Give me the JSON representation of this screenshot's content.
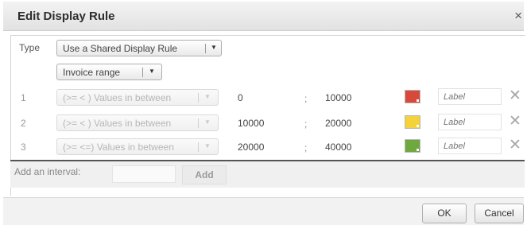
{
  "dialog": {
    "title": "Edit Display Rule",
    "close_symbol": "×"
  },
  "type_row": {
    "label": "Type",
    "value": "Use a Shared Display Rule"
  },
  "shared_rule": {
    "value": "Invoice range"
  },
  "intervals": [
    {
      "index": "1",
      "operator": "(>= < ) Values in between",
      "from": "0",
      "separator": ";",
      "to": "10000",
      "color": "#d7493a",
      "label_placeholder": "Label"
    },
    {
      "index": "2",
      "operator": "(>= < ) Values in between",
      "from": "10000",
      "separator": ";",
      "to": "20000",
      "color": "#f3d23c",
      "label_placeholder": "Label"
    },
    {
      "index": "3",
      "operator": "(>= <=) Values in between",
      "from": "20000",
      "separator": ";",
      "to": "40000",
      "color": "#6ea83e",
      "label_placeholder": "Label"
    }
  ],
  "remove_symbol": "✕",
  "add_interval": {
    "label": "Add an interval:",
    "button": "Add"
  },
  "footer": {
    "ok": "OK",
    "cancel": "Cancel"
  },
  "icons": {
    "close": "close-icon",
    "dropdown": "chevron-down-icon",
    "remove": "remove-icon"
  }
}
